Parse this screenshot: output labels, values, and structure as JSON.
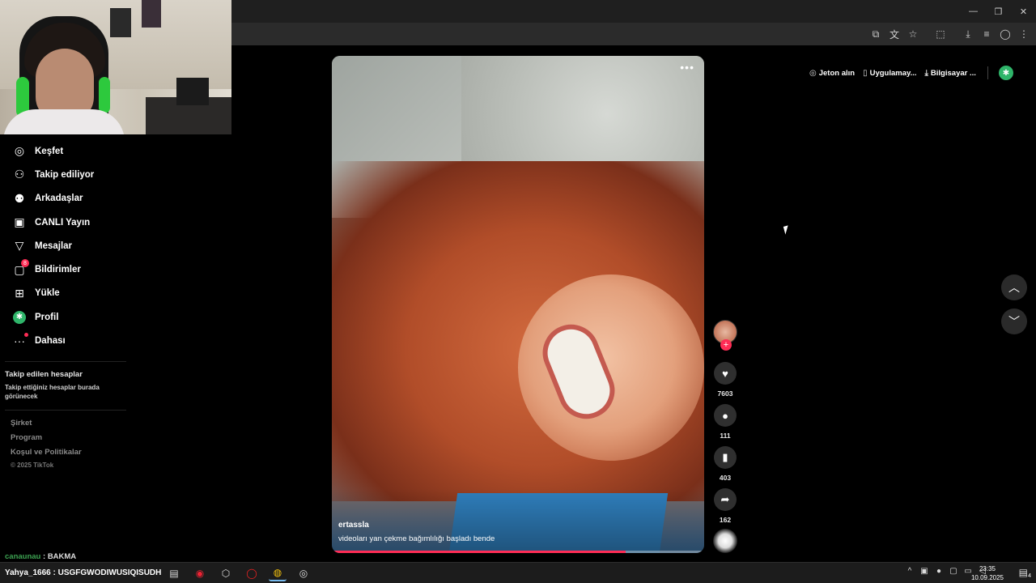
{
  "browser": {
    "window_controls": [
      "—",
      "❐",
      "✕"
    ],
    "toolbar_icons": [
      "install-icon",
      "translate-icon",
      "star-icon",
      "extensions-icon",
      "download-icon",
      "media-icon",
      "profile-icon",
      "menu-icon"
    ]
  },
  "sidebar": {
    "items": [
      {
        "label": "Keşfet",
        "icon": "compass-icon"
      },
      {
        "label": "Takip ediliyor",
        "icon": "following-icon"
      },
      {
        "label": "Arkadaşlar",
        "icon": "friends-icon"
      },
      {
        "label": "CANLI Yayın",
        "icon": "live-icon"
      },
      {
        "label": "Mesajlar",
        "icon": "messages-icon"
      },
      {
        "label": "Bildirimler",
        "icon": "notifications-icon",
        "badge": "8"
      },
      {
        "label": "Yükle",
        "icon": "upload-icon"
      },
      {
        "label": "Profil",
        "icon": "profile-avatar"
      },
      {
        "label": "Dahası",
        "icon": "more-icon"
      }
    ],
    "followed_title": "Takip edilen hesaplar",
    "followed_hint": "Takip ettiğiniz hesaplar burada görünecek",
    "footer": [
      "Şirket",
      "Program",
      "Koşul ve Politikalar"
    ],
    "copyright": "© 2025 TikTok"
  },
  "video": {
    "author": "ertassla",
    "caption": "videoları yan çekme bağımlılığı başladı bende",
    "more": "•••",
    "progress": 0.79
  },
  "actions": {
    "likes": "7603",
    "comments": "111",
    "saves": "403",
    "shares": "162"
  },
  "top_actions": {
    "coins": "Jeton alın",
    "app": "Uygulamay...",
    "pc": "Bilgisayar ..."
  },
  "chat": {
    "user": "canaunau",
    "sep": " : ",
    "message": "BAKMA"
  },
  "taskbar": {
    "stream_title": "Yahya_1666 : USGFGWODIWUSIQISUDH",
    "time": "23:35",
    "date": "10.09.2025",
    "notifications": "4"
  }
}
